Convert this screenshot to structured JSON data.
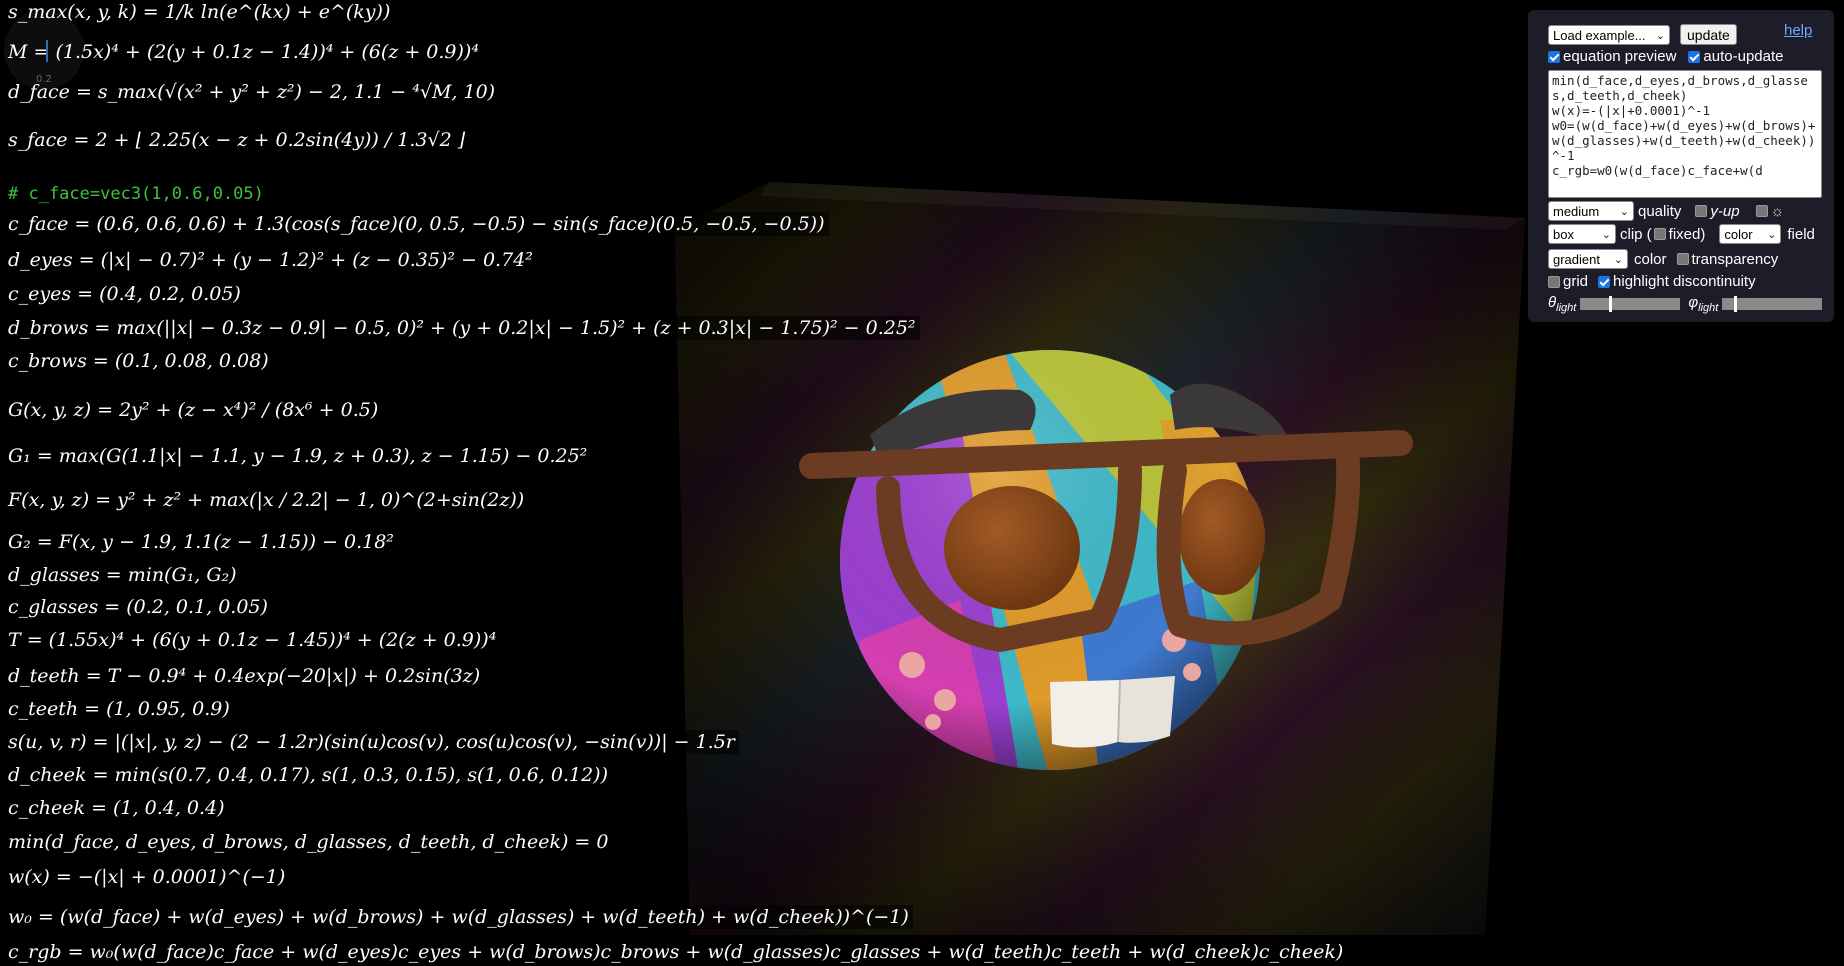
{
  "equations": [
    {
      "id": "smax",
      "text": "s_max(x, y, k) = 1/k ln(e^(kx) + e^(ky))"
    },
    {
      "id": "M",
      "text": "M = (1.5x)⁴ + (2(y + 0.1z − 1.4))⁴ + (6(z + 0.9))⁴"
    },
    {
      "id": "d_face",
      "text": "d_face = s_max(√(x² + y² + z²) − 2, 1.1 − ⁴√M, 10)"
    },
    {
      "id": "s_face",
      "text": "s_face = 2 + ⌊ 2.25(x − z + 0.2sin(4y)) / 1.3√2 ⌋"
    },
    {
      "id": "comment",
      "text": "# c_face=vec3(1,0.6,0.05)",
      "comment": true
    },
    {
      "id": "c_face",
      "text": "c_face = (0.6, 0.6, 0.6) + 1.3(cos(s_face)(0, 0.5, −0.5) − sin(s_face)(0.5, −0.5, −0.5))"
    },
    {
      "id": "d_eyes",
      "text": "d_eyes = (|x| − 0.7)² + (y − 1.2)² + (z − 0.35)² − 0.74²"
    },
    {
      "id": "c_eyes",
      "text": "c_eyes = (0.4, 0.2, 0.05)"
    },
    {
      "id": "d_brows",
      "text": "d_brows = max(||x| − 0.3z − 0.9| − 0.5, 0)² + (y + 0.2|x| − 1.5)² + (z + 0.3|x| − 1.75)² − 0.25²"
    },
    {
      "id": "c_brows",
      "text": "c_brows = (0.1, 0.08, 0.08)"
    },
    {
      "id": "G",
      "text": "G(x, y, z) = 2y² + (z − x⁴)² / (8x⁶ + 0.5)"
    },
    {
      "id": "G1",
      "text": "G₁ = max(G(1.1|x| − 1.1, y − 1.9, z + 0.3), z − 1.15) − 0.25²"
    },
    {
      "id": "F",
      "text": "F(x, y, z) = y² + z² + max(|x / 2.2| − 1, 0)^(2+sin(2z))"
    },
    {
      "id": "G2",
      "text": "G₂ = F(x, y − 1.9, 1.1(z − 1.15)) − 0.18²"
    },
    {
      "id": "d_glasses",
      "text": "d_glasses = min(G₁, G₂)"
    },
    {
      "id": "c_glasses",
      "text": "c_glasses = (0.2, 0.1, 0.05)"
    },
    {
      "id": "T",
      "text": "T = (1.55x)⁴ + (6(y + 0.1z − 1.45))⁴ + (2(z + 0.9))⁴"
    },
    {
      "id": "d_teeth",
      "text": "d_teeth = T − 0.9⁴ + 0.4exp(−20|x|) + 0.2sin(3z)"
    },
    {
      "id": "c_teeth",
      "text": "c_teeth = (1, 0.95, 0.9)"
    },
    {
      "id": "s_uvr",
      "text": "s(u, v, r) = |(|x|, y, z) − (2 − 1.2r)(sin(u)cos(v), cos(u)cos(v), −sin(v))| − 1.5r"
    },
    {
      "id": "d_cheek",
      "text": "d_cheek = min(s(0.7, 0.4, 0.17), s(1, 0.3, 0.15), s(1, 0.6, 0.12))"
    },
    {
      "id": "c_cheek",
      "text": "c_cheek = (1, 0.4, 0.4)"
    },
    {
      "id": "min_eq",
      "text": "min(d_face, d_eyes, d_brows, d_glasses, d_teeth, d_cheek) = 0"
    },
    {
      "id": "w",
      "text": "w(x) = −(|x| + 0.0001)^(−1)"
    },
    {
      "id": "w0",
      "text": "w₀ = (w(d_face) + w(d_eyes) + w(d_brows) + w(d_glasses) + w(d_teeth) + w(d_cheek))^(−1)"
    },
    {
      "id": "c_rgb",
      "text": "c_rgb = w₀(w(d_face)c_face + w(d_eyes)c_eyes + w(d_brows)c_brows + w(d_glasses)c_glasses + w(d_teeth)c_teeth + w(d_cheek)c_cheek)"
    }
  ],
  "axis": {
    "tick_label": "0.2"
  },
  "panel": {
    "load_example": "Load example...",
    "update": "update",
    "help": "help",
    "equation_preview": "equation preview",
    "auto_update": "auto-update",
    "source": "min(d_face,d_eyes,d_brows,d_glasses,d_teeth,d_cheek)\nw(x)=-(|x|+0.0001)^-1\nw0=(w(d_face)+w(d_eyes)+w(d_brows)+w(d_glasses)+w(d_teeth)+w(d_cheek))^-1\nc_rgb=w0(w(d_face)c_face+w(d",
    "quality_value": "medium",
    "quality_label": "quality",
    "y_up": "y-up",
    "clip_value": "box",
    "clip_label": "clip (",
    "fixed_label": "fixed)",
    "field_value": "color",
    "field_label": "field",
    "color_value": "gradient",
    "color_label": "color",
    "transparency": "transparency",
    "grid": "grid",
    "highlight": "highlight discontinuity",
    "theta": "θ",
    "phi": "φ",
    "light": "light",
    "theta_level": 0.3,
    "phi_level": 0.12
  },
  "colors": {
    "panel_bg": "#1d1d2a",
    "comment": "#3fc13f",
    "glasses": "#6b3c22",
    "eyes": "#8a4a20",
    "teeth": "#f2efe9",
    "link": "#6ea8ff"
  }
}
